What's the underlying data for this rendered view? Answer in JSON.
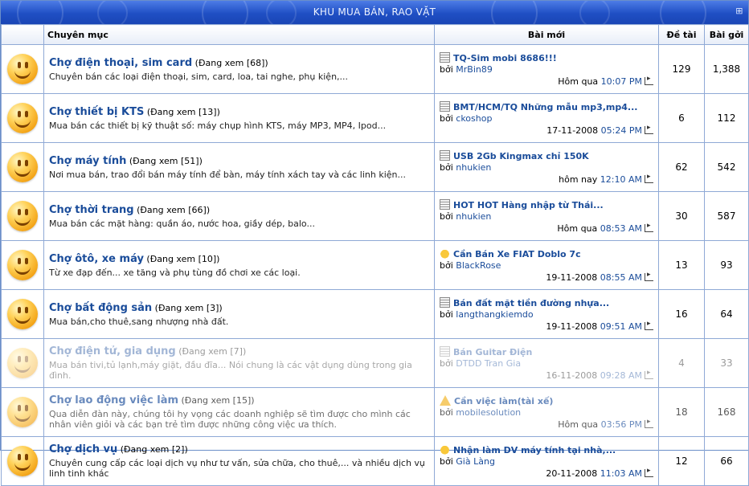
{
  "header": {
    "title": "KHU MUA BÁN, RAO VẶT"
  },
  "columns": {
    "forum": "Chuyên mục",
    "last_post": "Bài mới",
    "threads": "Đề tài",
    "posts": "Bài gởi"
  },
  "forums": [
    {
      "name": "Chợ điện thoại, sim card",
      "viewing": "(Đang xem [68])",
      "desc": "Chuyên bán các loại điện thoại, sim, card, loa, tai nghe, phụ kiện,...",
      "lp_icon": "document-icon",
      "lp_title": "TQ-Sim mobi 8686!!!",
      "lp_by": "bởi",
      "lp_user": "MrBin89",
      "lp_date": "Hôm qua",
      "lp_time": "10:07 PM",
      "threads": "129",
      "posts": "1,388",
      "faded": ""
    },
    {
      "name": "Chợ thiết bị KTS",
      "viewing": "(Đang xem [13])",
      "desc": "Mua bán các thiết bị kỹ thuật số: máy chụp hình KTS, máy MP3, MP4, Ipod...",
      "lp_icon": "document-icon",
      "lp_title": "BMT/HCM/TQ Những mẫu mp3,mp4...",
      "lp_by": "bởi",
      "lp_user": "ckoshop",
      "lp_date": "17-11-2008",
      "lp_time": "05:24 PM",
      "threads": "6",
      "posts": "112",
      "faded": ""
    },
    {
      "name": "Chợ máy tính",
      "viewing": "(Đang xem [51])",
      "desc": "Nơi mua bán, trao đổi bán máy tính để bàn, máy tính xách tay và các linh kiện...",
      "lp_icon": "document-icon",
      "lp_title": "USB 2Gb Kingmax chỉ 150K",
      "lp_by": "bởi",
      "lp_user": "nhukien",
      "lp_date": "hôm nay",
      "lp_time": "12:10 AM",
      "threads": "62",
      "posts": "542",
      "faded": ""
    },
    {
      "name": "Chợ thời trang",
      "viewing": "(Đang xem [66])",
      "desc": "Mua bán các mặt hàng: quần áo, nước hoa, giầy dép, balo...",
      "lp_icon": "document-icon",
      "lp_title": "HOT HOT Hàng nhập từ Thái...",
      "lp_by": "bởi",
      "lp_user": "nhukien",
      "lp_date": "Hôm qua",
      "lp_time": "08:53 AM",
      "threads": "30",
      "posts": "587",
      "faded": ""
    },
    {
      "name": "Chợ ôtô, xe máy",
      "viewing": "(Đang xem [10])",
      "desc": "Từ xe đạp đến... xe tăng và phụ tùng đồ chơi xe các loại.",
      "lp_icon": "thumbs-up-icon",
      "lp_title": "Cần Bán Xe FIAT Doblo 7c",
      "lp_by": "bởi",
      "lp_user": "BlackRose",
      "lp_date": "19-11-2008",
      "lp_time": "08:55 AM",
      "threads": "13",
      "posts": "93",
      "faded": ""
    },
    {
      "name": "Chợ bất động sản",
      "viewing": "(Đang xem [3])",
      "desc": "Mua bán,cho thuê,sang nhượng nhà đất.",
      "lp_icon": "document-icon",
      "lp_title": "Bán đất mặt tiền đường nhựa...",
      "lp_by": "bởi",
      "lp_user": "langthangkiemdo",
      "lp_date": "19-11-2008",
      "lp_time": "09:51 AM",
      "threads": "16",
      "posts": "64",
      "faded": ""
    },
    {
      "name": "Chợ điện tử, gia dụng",
      "viewing": "(Đang xem [7])",
      "desc": "Mua bán tivi,tủ lạnh,máy giặt, đầu đĩa... Nói chung là các vật dụng dùng trong gia đình.",
      "lp_icon": "document-icon",
      "lp_title": "Bán Guitar Điện",
      "lp_by": "bởi",
      "lp_user": "DTDD Tran Gia",
      "lp_date": "16-11-2008",
      "lp_time": "09:28 AM",
      "threads": "4",
      "posts": "33",
      "faded": "faded"
    },
    {
      "name": "Chợ lao động việc làm",
      "viewing": "(Đang xem [15])",
      "desc": "Qua diễn đàn này, chúng tôi hy vọng các doanh nghiệp sẽ tìm được cho mình các nhân viên giỏi và các bạn trẻ tìm được những công việc ưa thích.",
      "lp_icon": "warning-icon",
      "lp_title": "Cần việc làm(tài xế)",
      "lp_by": "bởi",
      "lp_user": "mobilesolution",
      "lp_date": "Hôm qua",
      "lp_time": "03:56 PM",
      "threads": "18",
      "posts": "168",
      "faded": "faded2"
    },
    {
      "name": "Chợ dịch vụ",
      "viewing": "(Đang xem [2])",
      "desc": "Chuyên cung cấp các loại dịch vụ như tư vấn, sửa chữa, cho thuê,... và nhiều dịch vụ linh tinh khác",
      "lp_icon": "thumbs-up-icon",
      "lp_title": "Nhận làm DV máy tính tại nhà,...",
      "lp_by": "bởi",
      "lp_user": "Già Làng",
      "lp_date": "20-11-2008",
      "lp_time": "11:03 AM",
      "threads": "12",
      "posts": "66",
      "faded": ""
    }
  ]
}
